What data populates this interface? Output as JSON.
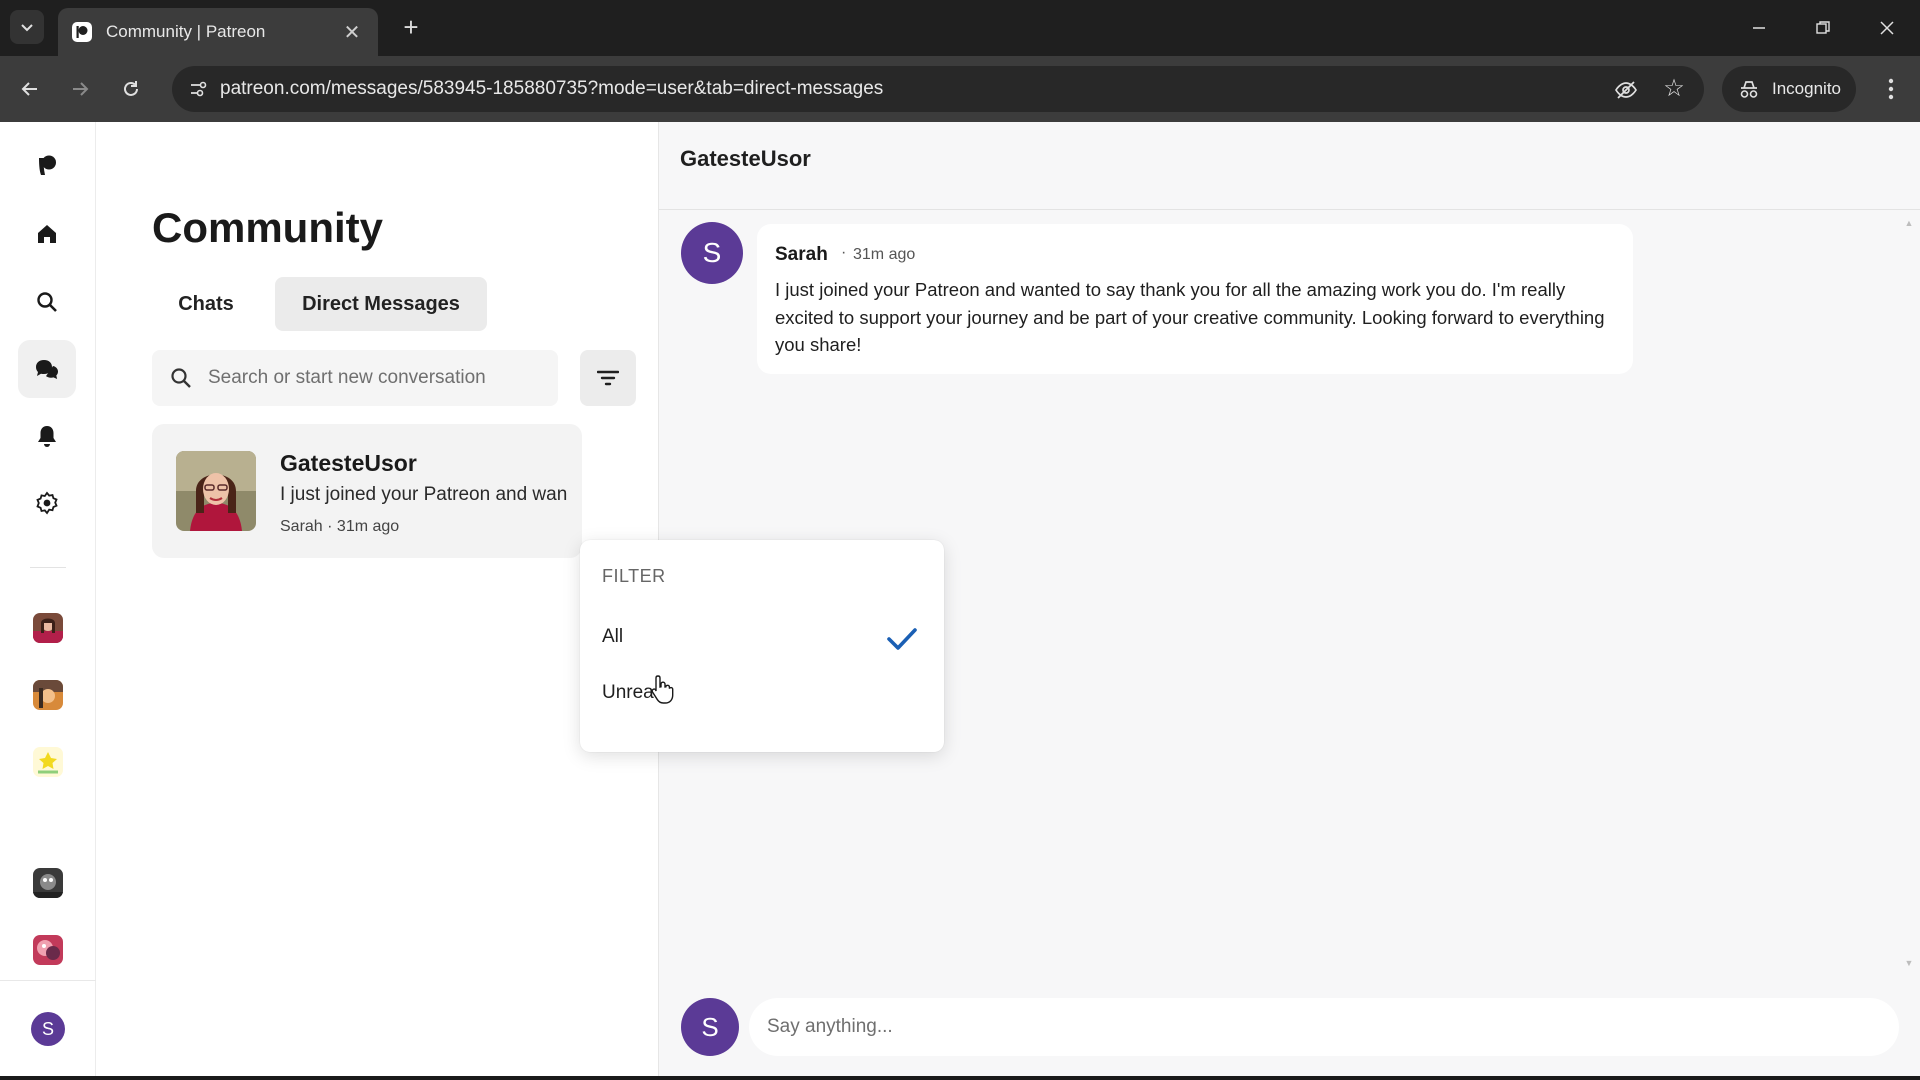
{
  "browser": {
    "tab_title": "Community | Patreon",
    "new_tab_symbol": "+",
    "close_symbol": "✕",
    "url": "patreon.com/messages/583945-185880735?mode=user&tab=direct-messages",
    "incognito_label": "Incognito"
  },
  "sidebar": {
    "user_initial": "S",
    "icons": [
      "patreon-logo-icon",
      "home-icon",
      "search-icon",
      "chat-icon",
      "bell-icon",
      "gear-icon"
    ]
  },
  "community": {
    "title": "Community",
    "tabs": [
      {
        "label": "Chats",
        "active": false
      },
      {
        "label": "Direct Messages",
        "active": true
      }
    ],
    "search_placeholder": "Search or start new conversation",
    "conversations": [
      {
        "name": "GatesteUsor",
        "preview": "I just joined your Patreon and wan",
        "meta": "Sarah · 31m ago"
      }
    ]
  },
  "filter_menu": {
    "heading": "FILTER",
    "options": [
      {
        "label": "All",
        "selected": true
      },
      {
        "label": "Unread",
        "selected": false
      }
    ]
  },
  "thread": {
    "title": "GatesteUsor",
    "messages": [
      {
        "avatar_initial": "S",
        "sender": "Sarah",
        "separator": "·",
        "time": "31m ago",
        "text": "I just joined your Patreon and wanted to say thank you for all the amazing work you do. I'm really excited to support your journey and be part of your creative community. Looking forward to everything you share!"
      }
    ],
    "composer_initial": "S",
    "composer_placeholder": "Say anything..."
  },
  "colors": {
    "avatar_purple": "#5b3a96",
    "check_blue": "#1a5fb4"
  }
}
